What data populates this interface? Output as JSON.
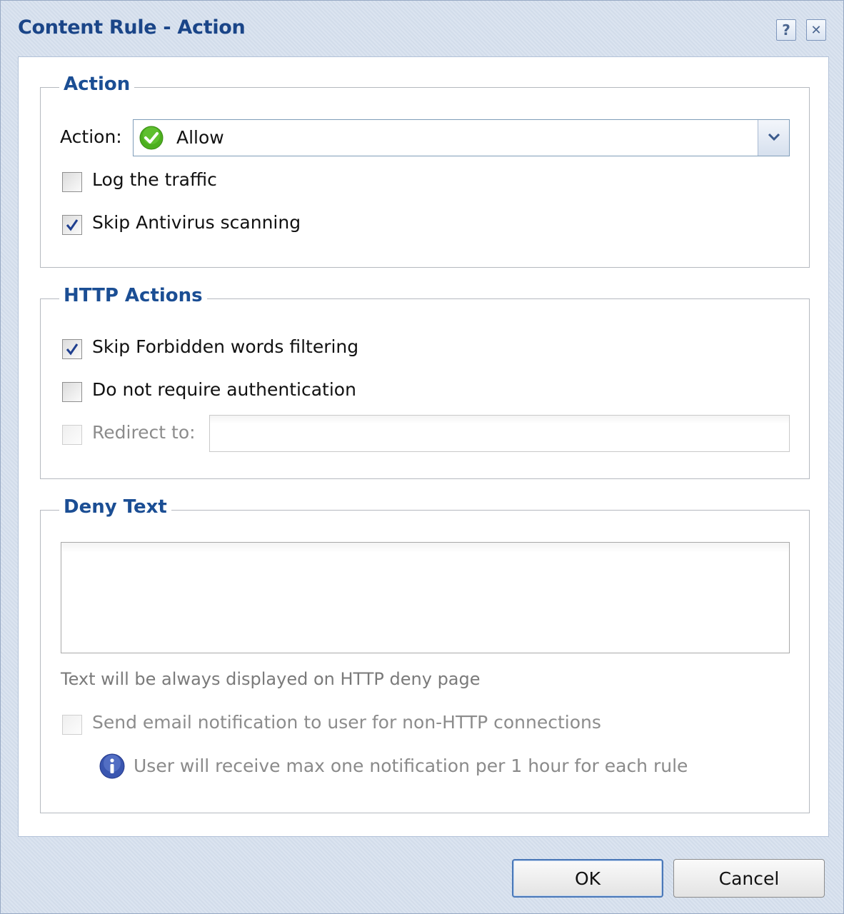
{
  "window": {
    "title": "Content Rule - Action",
    "help_label": "?",
    "close_label": "✕"
  },
  "action_group": {
    "legend": "Action",
    "action_label": "Action:",
    "action_value": "Allow",
    "log_traffic": {
      "label": "Log the traffic",
      "checked": false
    },
    "skip_antivirus": {
      "label": "Skip Antivirus scanning",
      "checked": true
    }
  },
  "http_group": {
    "legend": "HTTP Actions",
    "skip_forbidden": {
      "label": "Skip Forbidden words filtering",
      "checked": true
    },
    "no_auth": {
      "label": "Do not require authentication",
      "checked": false
    },
    "redirect": {
      "label": "Redirect to:",
      "checked": false,
      "value": ""
    }
  },
  "deny_group": {
    "legend": "Deny Text",
    "text_value": "",
    "hint": "Text will be always displayed on HTTP deny page",
    "email_notify": {
      "label": "Send email notification to user for non-HTTP connections",
      "checked": false
    },
    "info_text": "User will receive max one notification per 1 hour for each rule"
  },
  "buttons": {
    "ok": "OK",
    "cancel": "Cancel"
  },
  "colors": {
    "title": "#1a4588",
    "legend": "#1b4e94",
    "allow_icon": "#4caf1f",
    "info_icon": "#3a56b0"
  },
  "icons": {
    "allow": "check-circle-icon",
    "info": "info-icon",
    "dropdown": "chevron-down-icon"
  }
}
